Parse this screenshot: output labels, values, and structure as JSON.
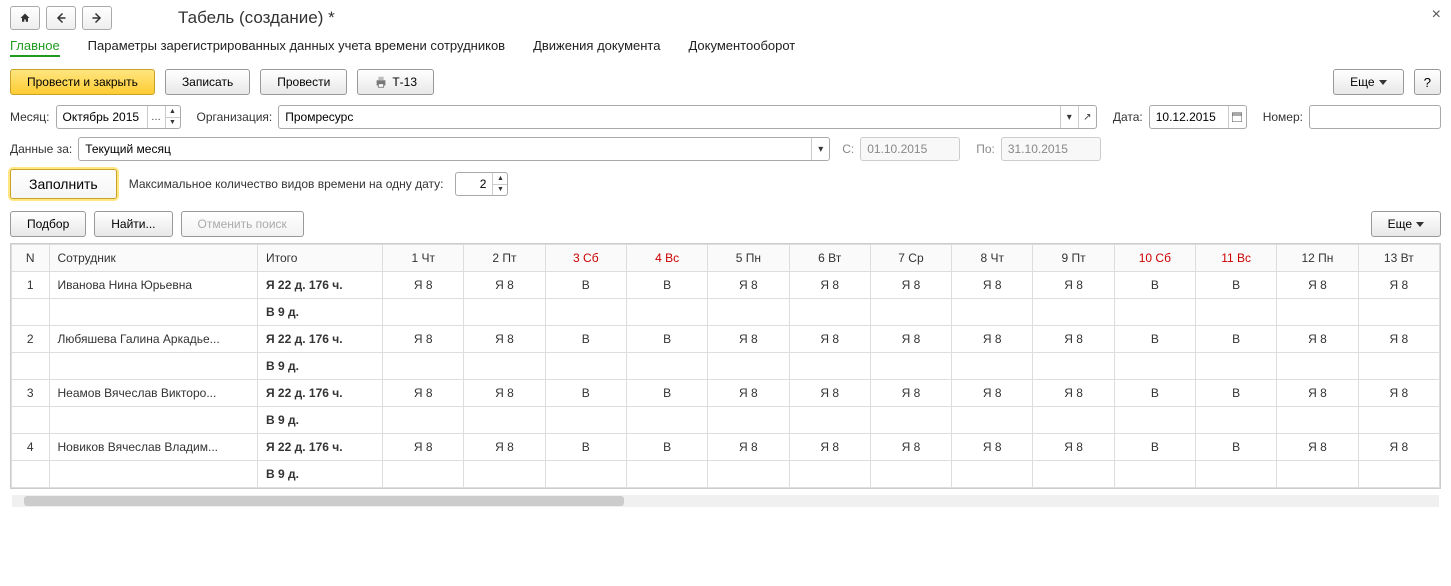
{
  "title": "Табель (создание) *",
  "tabs": {
    "main": "Главное",
    "params": "Параметры зарегистрированных данных учета времени сотрудников",
    "moves": "Движения документа",
    "docflow": "Документооборот"
  },
  "tb": {
    "post_close": "Провести и закрыть",
    "save": "Записать",
    "post": "Провести",
    "t13": "Т-13",
    "more": "Еще",
    "question": "?"
  },
  "form": {
    "month_lbl": "Месяц:",
    "month_val": "Октябрь 2015",
    "org_lbl": "Организация:",
    "org_val": "Промресурс",
    "date_lbl": "Дата:",
    "date_val": "10.12.2015",
    "num_lbl": "Номер:",
    "num_val": "",
    "dataza_lbl": "Данные за:",
    "dataza_val": "Текущий месяц",
    "from_lbl": "С:",
    "from_val": "01.10.2015",
    "to_lbl": "По:",
    "to_val": "31.10.2015"
  },
  "fill": {
    "btn": "Заполнить",
    "max_lbl": "Максимальное количество видов времени на одну дату:",
    "max_val": "2"
  },
  "tb2": {
    "pick": "Подбор",
    "find": "Найти...",
    "cancel_find": "Отменить поиск",
    "more": "Еще"
  },
  "headers": {
    "n": "N",
    "emp": "Сотрудник",
    "sum": "Итого",
    "days": [
      {
        "l": "1 Чт",
        "w": false
      },
      {
        "l": "2 Пт",
        "w": false
      },
      {
        "l": "3 Сб",
        "w": true
      },
      {
        "l": "4 Вс",
        "w": true
      },
      {
        "l": "5 Пн",
        "w": false
      },
      {
        "l": "6 Вт",
        "w": false
      },
      {
        "l": "7 Ср",
        "w": false
      },
      {
        "l": "8 Чт",
        "w": false
      },
      {
        "l": "9 Пт",
        "w": false
      },
      {
        "l": "10 Сб",
        "w": true
      },
      {
        "l": "11 Вс",
        "w": true
      },
      {
        "l": "12 Пн",
        "w": false
      },
      {
        "l": "13 Вт",
        "w": false
      }
    ]
  },
  "rows": [
    {
      "n": "1",
      "name": "Иванова Нина Юрьевна",
      "sum1": "Я 22 д.  176 ч.",
      "sum2": "В 9 д.",
      "cells": [
        "Я 8",
        "Я 8",
        "В",
        "В",
        "Я 8",
        "Я 8",
        "Я 8",
        "Я 8",
        "Я 8",
        "В",
        "В",
        "Я 8",
        "Я 8"
      ]
    },
    {
      "n": "2",
      "name": "Любяшева Галина Аркадье...",
      "sum1": "Я 22 д.  176 ч.",
      "sum2": "В 9 д.",
      "cells": [
        "Я 8",
        "Я 8",
        "В",
        "В",
        "Я 8",
        "Я 8",
        "Я 8",
        "Я 8",
        "Я 8",
        "В",
        "В",
        "Я 8",
        "Я 8"
      ]
    },
    {
      "n": "3",
      "name": "Неамов Вячеслав Викторо...",
      "sum1": "Я 22 д.  176 ч.",
      "sum2": "В 9 д.",
      "cells": [
        "Я 8",
        "Я 8",
        "В",
        "В",
        "Я 8",
        "Я 8",
        "Я 8",
        "Я 8",
        "Я 8",
        "В",
        "В",
        "Я 8",
        "Я 8"
      ]
    },
    {
      "n": "4",
      "name": "Новиков Вячеслав Владим...",
      "sum1": "Я 22 д.  176 ч.",
      "sum2": "В 9 д.",
      "cells": [
        "Я 8",
        "Я 8",
        "В",
        "В",
        "Я 8",
        "Я 8",
        "Я 8",
        "Я 8",
        "Я 8",
        "В",
        "В",
        "Я 8",
        "Я 8"
      ]
    }
  ]
}
